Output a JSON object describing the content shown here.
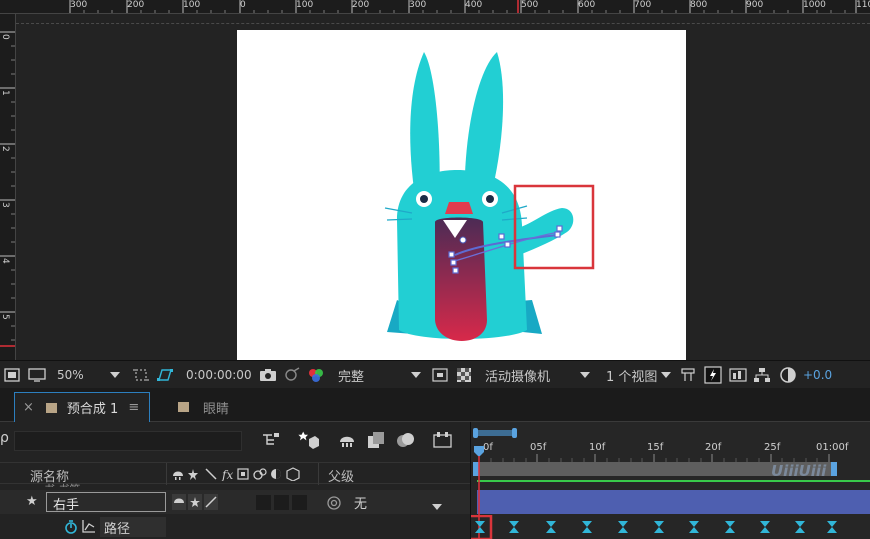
{
  "rulers": {
    "top_labels": [
      "300",
      "200",
      "100",
      "0",
      "100",
      "200",
      "300",
      "400",
      "500",
      "600",
      "700",
      "800",
      "900",
      "1000",
      "110"
    ],
    "left_labels": [
      "0",
      "1",
      "2",
      "3",
      "4",
      "5"
    ]
  },
  "colors": {
    "bunny": "#22cfd3",
    "bunny_dark": "#18a9c4",
    "mouth_top": "#4b2b55",
    "mouth_bottom": "#d8294a",
    "nose": "#e23b4e",
    "highlight_box": "#d9353b",
    "accent_blue": "#2c7fbf",
    "keyframe": "#31b6d8",
    "time_green": "#38c94a"
  },
  "viewer_toolbar": {
    "zoom": "50%",
    "timecode": "0:00:00:00",
    "resolution": "完整",
    "camera": "活动摄像机",
    "views": "1 个视图",
    "exposure": "+0.0"
  },
  "tabs": {
    "active_label": "预合成 1",
    "inactive_label": "眼睛",
    "close_glyph": "×",
    "menu_glyph": "≡"
  },
  "timeline": {
    "search_glyph": "ρ",
    "header_source": "源名称",
    "header_parent": "父级",
    "cut_layer_text": "书 书笔",
    "layer": {
      "name": "右手",
      "parent": "无"
    },
    "property": {
      "name": "路径"
    },
    "ruler_labels": [
      "0f",
      "05f",
      "10f",
      "15f",
      "20f",
      "25f",
      "01:00f"
    ]
  },
  "watermark": "UiiiUiii"
}
